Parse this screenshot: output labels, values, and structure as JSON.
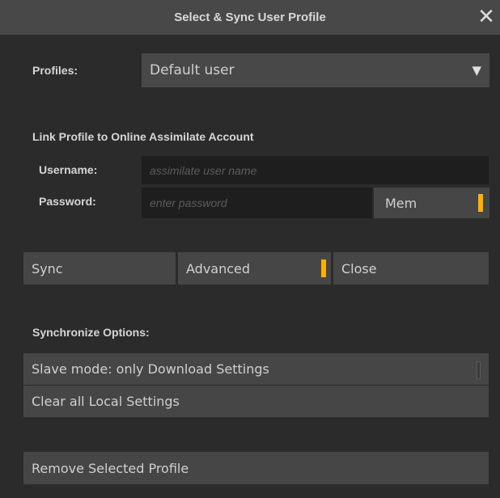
{
  "window": {
    "title": "Select & Sync User Profile",
    "close_icon": "close-icon"
  },
  "profiles": {
    "label": "Profiles:",
    "selected": "Default user",
    "arrow_icon": "triangle-down-icon"
  },
  "link": {
    "heading": "Link Profile to Online Assimilate Account",
    "username_label": "Username:",
    "username_placeholder": "assimilate user name",
    "password_label": "Password:",
    "password_placeholder": "enter password",
    "mem_label": "Mem"
  },
  "actions": {
    "sync_label": "Sync",
    "advanced_label": "Advanced",
    "close_label": "Close"
  },
  "sync_options": {
    "heading": "Synchronize Options:",
    "slave_mode_label": "Slave mode: only Download Settings",
    "clear_label": "Clear all Local Settings"
  },
  "remove_label": "Remove Selected Profile",
  "colors": {
    "accent": "#ffb000",
    "button_bg": "#464646",
    "field_bg": "#1e1e1e",
    "panel_bg": "#2b2b2b"
  }
}
